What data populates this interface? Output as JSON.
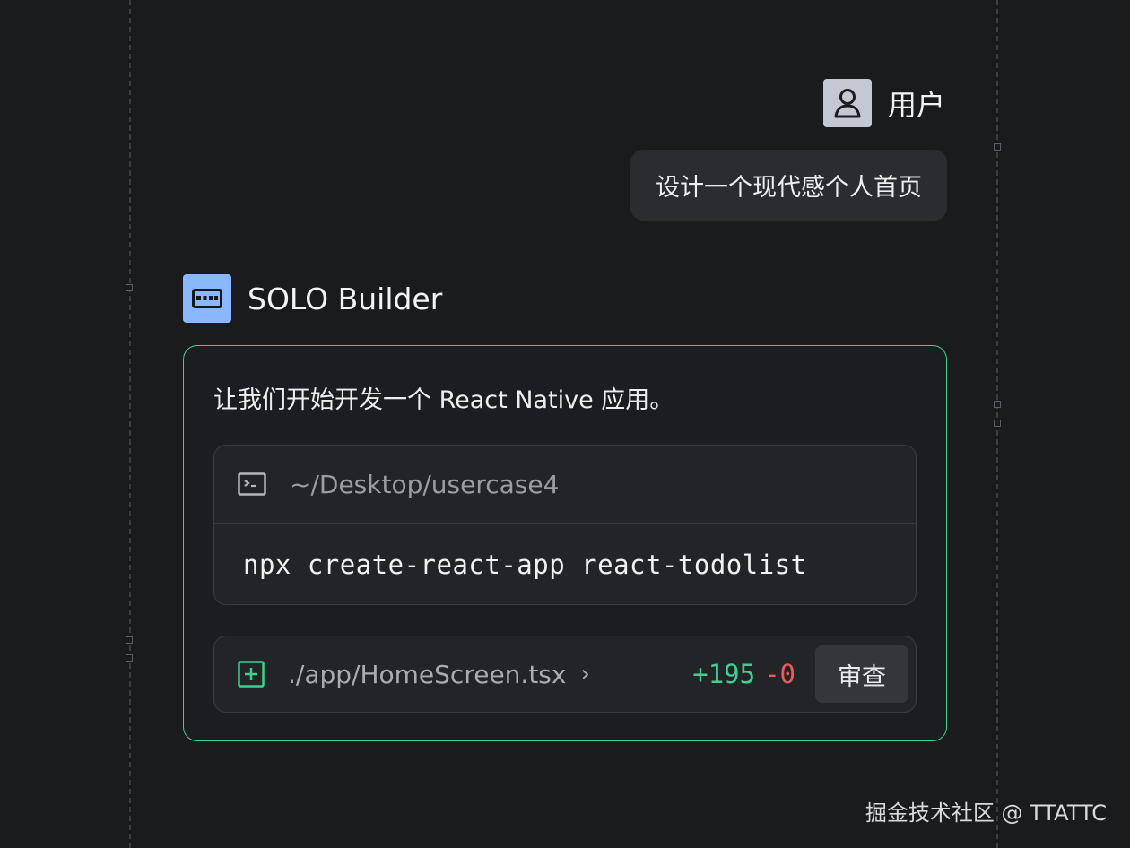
{
  "user": {
    "name": "用户",
    "message": "设计一个现代感个人首页"
  },
  "bot": {
    "name": "SOLO Builder",
    "intro": "让我们开始开发一个 React Native 应用。",
    "terminal": {
      "path": "~/Desktop/usercase4",
      "command": "npx create-react-app react-todolist"
    },
    "file": {
      "path": "./app/HomeScreen.tsx",
      "chevron": "›",
      "additions": "+195",
      "deletions": "-0",
      "review_label": "审查"
    }
  },
  "watermark": "掘金技术社区 @ TTATTC",
  "colors": {
    "accent_green": "#3fcf8e",
    "deletion_red": "#f0585a",
    "bot_avatar": "#8ab8ff",
    "background": "#1a1b1d"
  }
}
